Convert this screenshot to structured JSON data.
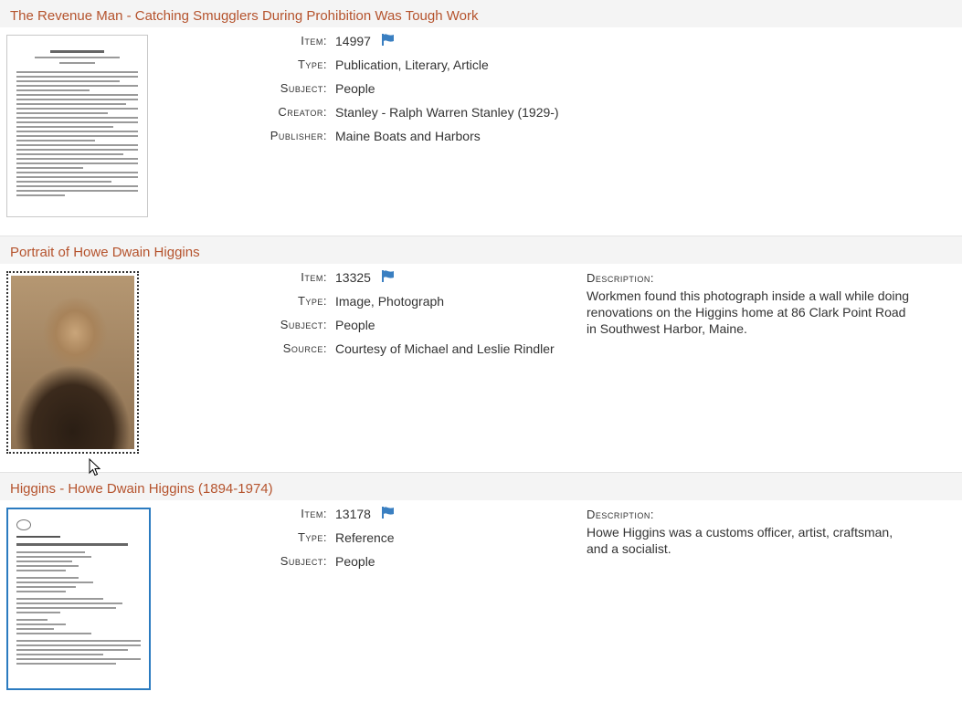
{
  "items": [
    {
      "title": "The Revenue Man - Catching Smugglers During Prohibition Was Tough Work",
      "fields": [
        {
          "label": "Item:",
          "value": "14997",
          "flag": true
        },
        {
          "label": "Type:",
          "value": "Publication, Literary, Article"
        },
        {
          "label": "Subject:",
          "value": "People"
        },
        {
          "label": "Creator:",
          "value": "Stanley - Ralph Warren Stanley (1929-)"
        },
        {
          "label": "Publisher:",
          "value": "Maine Boats and Harbors"
        }
      ],
      "thumbnail": {
        "kind": "document",
        "heading": "The Revenue Man"
      }
    },
    {
      "title": "Portrait of Howe Dwain Higgins",
      "fields": [
        {
          "label": "Item:",
          "value": "13325",
          "flag": true
        },
        {
          "label": "Type:",
          "value": "Image, Photograph"
        },
        {
          "label": "Subject:",
          "value": "People"
        },
        {
          "label": "Source:",
          "value": "Courtesy of Michael and Leslie Rindler"
        }
      ],
      "description": {
        "label": "Description:",
        "text": "Workmen found this photograph inside a wall while doing renovations on the Higgins home at 86 Clark Point Road in Southwest Harbor, Maine."
      },
      "thumbnail": {
        "kind": "photo"
      }
    },
    {
      "title": "Higgins - Howe Dwain Higgins (1894-1974)",
      "fields": [
        {
          "label": "Item:",
          "value": "13178",
          "flag": true
        },
        {
          "label": "Type:",
          "value": "Reference"
        },
        {
          "label": "Subject:",
          "value": "People"
        }
      ],
      "description": {
        "label": "Description:",
        "text": "Howe Higgins was a customs officer, artist, craftsman, and a socialist."
      },
      "thumbnail": {
        "kind": "document",
        "heading": "Biography"
      }
    }
  ],
  "colors": {
    "title": "#b5532d",
    "flag": "#3a7fc1",
    "header_bg": "#f4f4f4"
  },
  "icons": {
    "flag": "flag-icon",
    "cursor": "mouse-pointer-icon"
  }
}
